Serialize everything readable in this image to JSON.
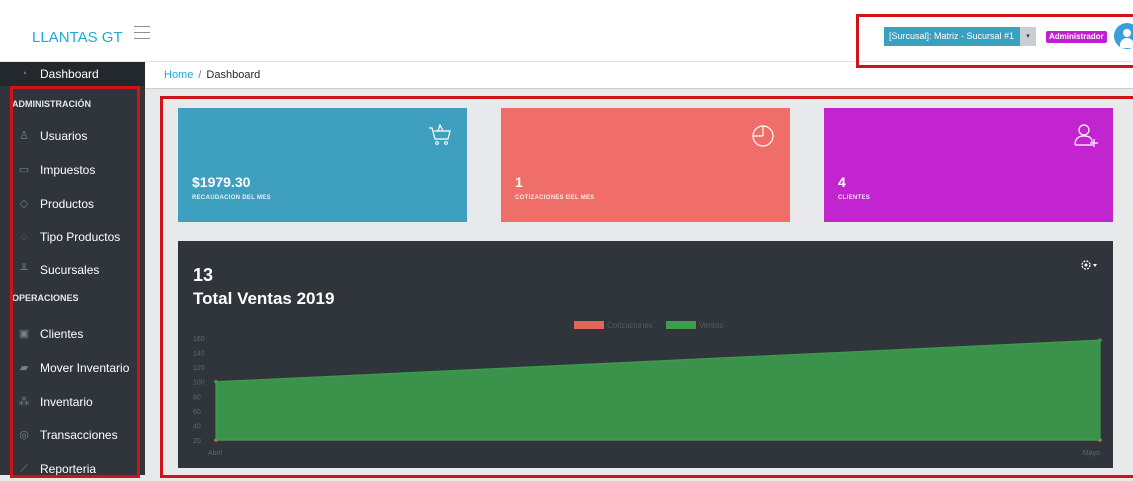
{
  "header": {
    "brand": "LLANTAS GT",
    "branch_selector": "[Surcusal]: Matriz - Sucursal #1",
    "branch_caret": "▾",
    "role_badge": "Administrador"
  },
  "sidebar": {
    "dashboard": {
      "label": "Dashboard",
      "icon": "speedometer-icon"
    },
    "section_admin": "ADMINISTRACIÓN",
    "admin_items": [
      {
        "label": "Usuarios",
        "icon": "user-icon"
      },
      {
        "label": "Impuestos",
        "icon": "window-icon"
      },
      {
        "label": "Productos",
        "icon": "tag-icon"
      },
      {
        "label": "Tipo Productos",
        "icon": "tags-icon"
      },
      {
        "label": "Sucursales",
        "icon": "chart-icon"
      }
    ],
    "section_ops": "OPERACIONES",
    "ops_items": [
      {
        "label": "Clientes",
        "icon": "id-card-icon"
      },
      {
        "label": "Mover Inventario",
        "icon": "truck-icon"
      },
      {
        "label": "Inventario",
        "icon": "boxes-icon"
      },
      {
        "label": "Transacciones",
        "icon": "dollar-icon"
      },
      {
        "label": "Reporteria",
        "icon": "line-chart-icon"
      }
    ]
  },
  "breadcrumb": {
    "home": "Home",
    "separator": "/",
    "current": "Dashboard"
  },
  "cards": [
    {
      "value": "$1979.30",
      "label": "RECAUDACION DEL MES",
      "color": "#3f9fbf",
      "icon": "basket-icon"
    },
    {
      "value": "1",
      "label": "COTIZACIONES DEL MES",
      "color": "#f06e6a",
      "icon": "pie-icon"
    },
    {
      "value": "4",
      "label": "CLIENTES",
      "color": "#c224cf",
      "icon": "user-add-icon"
    }
  ],
  "chart_panel": {
    "number": "13",
    "title": "Total Ventas 2019",
    "settings_icon": "gear-icon"
  },
  "colors": {
    "accent": "#20a8d8",
    "sidebar_bg": "#2f353a",
    "highlight": "#d0131b",
    "series_cotizaciones": "#e3655b",
    "series_ventas": "#3d9c4e"
  },
  "chart_data": {
    "type": "area",
    "categories": [
      "Abril",
      "Mayo"
    ],
    "series": [
      {
        "name": "Cotizaciones",
        "values": [
          0,
          0
        ]
      },
      {
        "name": "Ventas",
        "values": [
          100,
          157
        ]
      }
    ],
    "y_ticks": [
      20,
      40,
      60,
      80,
      100,
      120,
      140,
      160
    ],
    "ylim": [
      20,
      160
    ],
    "legend_position": "top-center",
    "grid": false
  }
}
